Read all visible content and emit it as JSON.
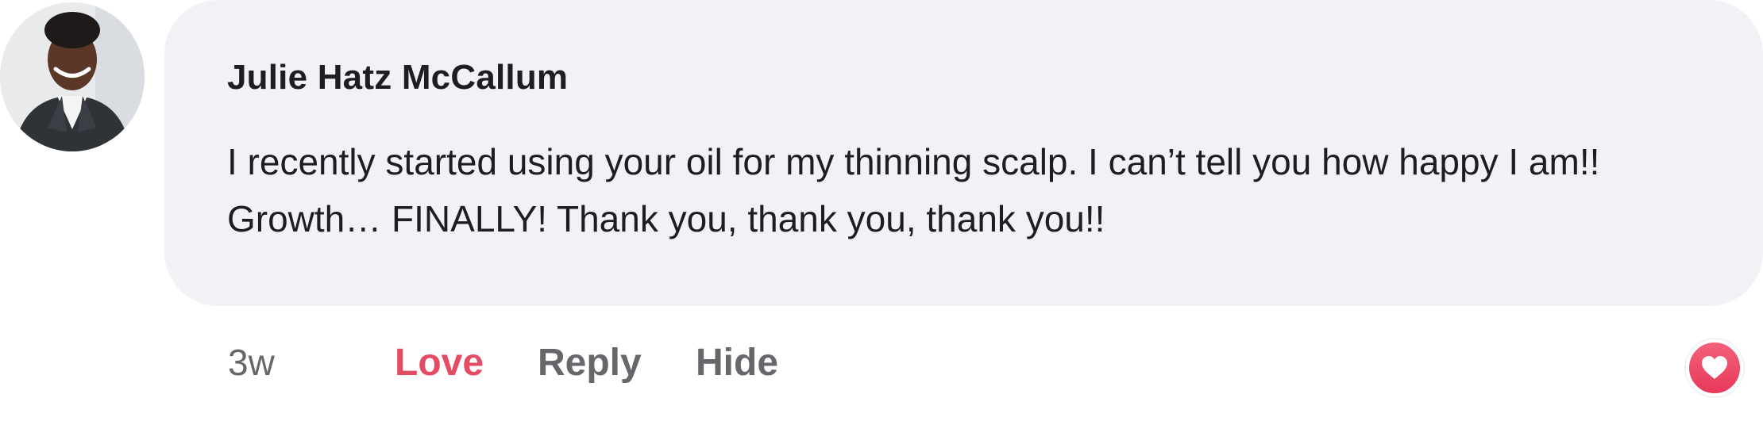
{
  "comment": {
    "author": "Julie Hatz McCallum",
    "text": "I recently started using your oil for my thinning scalp. I can’t tell you how happy I am!! Growth… FINALLY! Thank you, thank you, thank you!!",
    "timestamp": "3w",
    "actions": {
      "love": "Love",
      "reply": "Reply",
      "hide": "Hide"
    },
    "reaction_icon": "heart-icon",
    "avatar_icon": "profile-photo"
  },
  "colors": {
    "bubble": "#f0f2f5",
    "love": "#e44c64",
    "muted": "#65676b",
    "text": "#1c1e21"
  }
}
